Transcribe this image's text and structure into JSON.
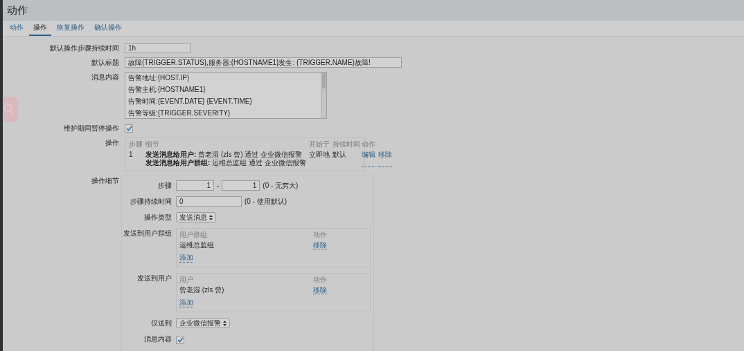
{
  "page": {
    "title": "动作"
  },
  "tabs": [
    {
      "label": "动作",
      "selected": false
    },
    {
      "label": "操作",
      "selected": true
    },
    {
      "label": "恢复操作",
      "selected": false
    },
    {
      "label": "确认操作",
      "selected": false
    }
  ],
  "form": {
    "default_step_duration": {
      "label": "默认操作步骤持续时间",
      "value": "1h"
    },
    "default_subject": {
      "label": "默认标题",
      "value": "故障{TRIGGER.STATUS},服务器:{HOSTNAME1}发生: {TRIGGER.NAME}故障!"
    },
    "default_message": {
      "label": "消息内容",
      "lines": [
        "告警地址:{HOST.IP}",
        "告警主机:{HOSTNAME1}",
        "告警时间:{EVENT.DATE} {EVENT.TIME}",
        "告警等级:{TRIGGER.SEVERITY}"
      ]
    },
    "pause_in_maintenance": {
      "label": "维护期间暂停操作",
      "checked": true
    },
    "operations": {
      "label": "操作",
      "columns": [
        "步骤",
        "细节",
        "开始于",
        "持续时间",
        "动作"
      ],
      "rows": [
        {
          "step": "1",
          "details": [
            "**发送消息给用户:** 曾老湿 (zls 曾) 通过 企业微信报警",
            "**发送消息给用户群组:** 运维总监组 通过 企业微信报警"
          ],
          "start": "立即地",
          "duration": "默认",
          "actions": [
            "编辑",
            "移除"
          ]
        }
      ]
    }
  },
  "operation_details": {
    "label": "操作细节",
    "steps": {
      "label": "步骤",
      "from": "1",
      "separator": "-",
      "to": "1",
      "hint": "(0 - 无穷大)"
    },
    "step_duration": {
      "label": "步骤持续时间",
      "value": "0",
      "hint": "(0 - 使用默认)"
    },
    "operation_type": {
      "label": "操作类型",
      "value": "发送消息"
    },
    "user_groups": {
      "label": "发送到用户群组",
      "columns": [
        "用户群组",
        "动作"
      ],
      "rows": [
        {
          "name": "运维总监组",
          "action": "移除"
        }
      ],
      "add": "添加"
    },
    "users": {
      "label": "发送到用户",
      "columns": [
        "用户",
        "动作"
      ],
      "rows": [
        {
          "name": "曾老湿 (zls 曾)",
          "action": "移除"
        }
      ],
      "add": "添加"
    },
    "send_only_to": {
      "label": "仅送到",
      "value": "企业微信报警"
    },
    "default_message": {
      "label": "消息内容",
      "checked": true
    }
  }
}
